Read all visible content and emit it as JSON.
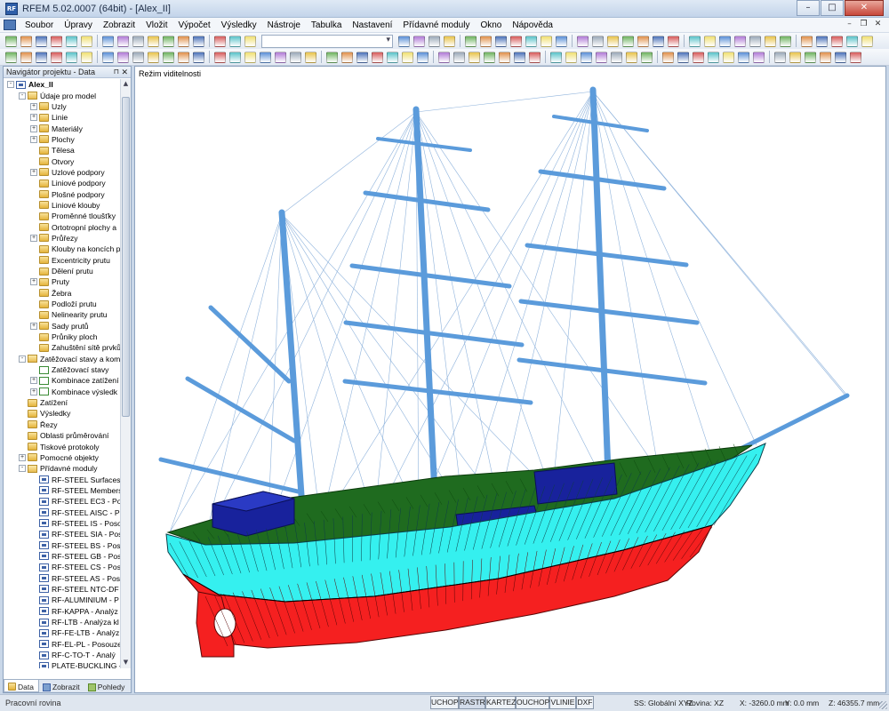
{
  "window": {
    "title": "RFEM 5.02.0007 (64bit) - [Alex_II]",
    "app_icon": "rfem-app-icon",
    "min": "–",
    "max": "□",
    "close": "✕"
  },
  "menu": [
    "Soubor",
    "Úpravy",
    "Zobrazit",
    "Vložit",
    "Výpočet",
    "Výsledky",
    "Nástroje",
    "Tabulka",
    "Nastavení",
    "Přídavné moduly",
    "Okno",
    "Nápověda"
  ],
  "navigator": {
    "title": "Navigátor projektu - Data",
    "tree": [
      {
        "label": "Alex_II",
        "level": 0,
        "exp": "-",
        "icon": "rf"
      },
      {
        "label": "Údaje pro model",
        "level": 1,
        "exp": "-",
        "icon": "fold-open"
      },
      {
        "label": "Uzly",
        "level": 2,
        "exp": "+",
        "icon": "fold"
      },
      {
        "label": "Linie",
        "level": 2,
        "exp": "+",
        "icon": "fold"
      },
      {
        "label": "Materiály",
        "level": 2,
        "exp": "+",
        "icon": "fold"
      },
      {
        "label": "Plochy",
        "level": 2,
        "exp": "+",
        "icon": "fold"
      },
      {
        "label": "Tělesa",
        "level": 2,
        "exp": "",
        "icon": "fold"
      },
      {
        "label": "Otvory",
        "level": 2,
        "exp": "",
        "icon": "fold"
      },
      {
        "label": "Uzlové podpory",
        "level": 2,
        "exp": "+",
        "icon": "fold"
      },
      {
        "label": "Liniové podpory",
        "level": 2,
        "exp": "",
        "icon": "fold"
      },
      {
        "label": "Plošné podpory",
        "level": 2,
        "exp": "",
        "icon": "fold"
      },
      {
        "label": "Liniové klouby",
        "level": 2,
        "exp": "",
        "icon": "fold"
      },
      {
        "label": "Proměnné tloušťky",
        "level": 2,
        "exp": "",
        "icon": "fold"
      },
      {
        "label": "Ortotropní plochy a",
        "level": 2,
        "exp": "",
        "icon": "fold"
      },
      {
        "label": "Průřezy",
        "level": 2,
        "exp": "+",
        "icon": "fold"
      },
      {
        "label": "Klouby na koncích p",
        "level": 2,
        "exp": "",
        "icon": "fold"
      },
      {
        "label": "Excentricity prutu",
        "level": 2,
        "exp": "",
        "icon": "fold"
      },
      {
        "label": "Dělení prutu",
        "level": 2,
        "exp": "",
        "icon": "fold"
      },
      {
        "label": "Pruty",
        "level": 2,
        "exp": "+",
        "icon": "fold"
      },
      {
        "label": "Žebra",
        "level": 2,
        "exp": "",
        "icon": "fold"
      },
      {
        "label": "Podloží prutu",
        "level": 2,
        "exp": "",
        "icon": "fold"
      },
      {
        "label": "Nelinearity prutu",
        "level": 2,
        "exp": "",
        "icon": "fold"
      },
      {
        "label": "Sady prutů",
        "level": 2,
        "exp": "+",
        "icon": "fold"
      },
      {
        "label": "Průniky ploch",
        "level": 2,
        "exp": "",
        "icon": "fold"
      },
      {
        "label": "Zahuštění sítě prvků",
        "level": 2,
        "exp": "",
        "icon": "fold"
      },
      {
        "label": "Zatěžovací stavy a kom",
        "level": 1,
        "exp": "-",
        "icon": "fold-open"
      },
      {
        "label": "Zatěžovací stavy",
        "level": 2,
        "exp": "",
        "icon": "lc"
      },
      {
        "label": "Kombinace zatížení",
        "level": 2,
        "exp": "+",
        "icon": "lc"
      },
      {
        "label": "Kombinace výsledk",
        "level": 2,
        "exp": "+",
        "icon": "lc"
      },
      {
        "label": "Zatížení",
        "level": 1,
        "exp": "",
        "icon": "fold"
      },
      {
        "label": "Výsledky",
        "level": 1,
        "exp": "",
        "icon": "fold"
      },
      {
        "label": "Řezy",
        "level": 1,
        "exp": "",
        "icon": "fold"
      },
      {
        "label": "Oblasti průměrování",
        "level": 1,
        "exp": "",
        "icon": "fold"
      },
      {
        "label": "Tiskové protokoly",
        "level": 1,
        "exp": "",
        "icon": "fold"
      },
      {
        "label": "Pomocné objekty",
        "level": 1,
        "exp": "+",
        "icon": "fold"
      },
      {
        "label": "Přídavné moduly",
        "level": 1,
        "exp": "-",
        "icon": "fold-open"
      },
      {
        "label": "RF-STEEL Surfaces -",
        "level": 2,
        "exp": "",
        "icon": "rf"
      },
      {
        "label": "RF-STEEL Members",
        "level": 2,
        "exp": "",
        "icon": "rf"
      },
      {
        "label": "RF-STEEL EC3 - Pos",
        "level": 2,
        "exp": "",
        "icon": "rf"
      },
      {
        "label": "RF-STEEL AISC - Po",
        "level": 2,
        "exp": "",
        "icon": "rf"
      },
      {
        "label": "RF-STEEL IS - Posou",
        "level": 2,
        "exp": "",
        "icon": "rf"
      },
      {
        "label": "RF-STEEL SIA - Pos",
        "level": 2,
        "exp": "",
        "icon": "rf"
      },
      {
        "label": "RF-STEEL BS - Poso",
        "level": 2,
        "exp": "",
        "icon": "rf"
      },
      {
        "label": "RF-STEEL GB - Poso",
        "level": 2,
        "exp": "",
        "icon": "rf"
      },
      {
        "label": "RF-STEEL CS - Poso",
        "level": 2,
        "exp": "",
        "icon": "rf"
      },
      {
        "label": "RF-STEEL AS - Poso",
        "level": 2,
        "exp": "",
        "icon": "rf"
      },
      {
        "label": "RF-STEEL NTC-DF -",
        "level": 2,
        "exp": "",
        "icon": "rf"
      },
      {
        "label": "RF-ALUMINIUM - P",
        "level": 2,
        "exp": "",
        "icon": "rf"
      },
      {
        "label": "RF-KAPPA - Analýz",
        "level": 2,
        "exp": "",
        "icon": "rf"
      },
      {
        "label": "RF-LTB - Analýza kl",
        "level": 2,
        "exp": "",
        "icon": "rf"
      },
      {
        "label": "RF-FE-LTB - Analýz",
        "level": 2,
        "exp": "",
        "icon": "rf"
      },
      {
        "label": "RF-EL-PL - Posouze",
        "level": 2,
        "exp": "",
        "icon": "rf"
      },
      {
        "label": "RF-C-TO-T - Analý",
        "level": 2,
        "exp": "",
        "icon": "rf"
      },
      {
        "label": "PLATE-BUCKLING -",
        "level": 2,
        "exp": "",
        "icon": "rf"
      }
    ],
    "tabs": [
      "Data",
      "Zobrazit",
      "Pohledy"
    ]
  },
  "viewport": {
    "label": "Režim viditelnosti"
  },
  "status": {
    "text": "Pracovní rovina",
    "buttons": [
      "UCHOP",
      "RASTR",
      "KARTEZ",
      "OUCHOP",
      "VLINIE",
      "DXF"
    ],
    "ss": "SS: Globální XYZ",
    "plane": "Rovina: XZ",
    "x": "X: -3260.0 mm",
    "y": "Y: 0.0 mm",
    "z": "Z: 46355.7 mm"
  },
  "colors": {
    "hull_upper": "#35f0ef",
    "hull_lower": "#f52020",
    "deck": "#1f6b1f",
    "deckhouse": "#18229c",
    "spar": "#5b9bdb",
    "rigging": "#8fb3dc"
  }
}
